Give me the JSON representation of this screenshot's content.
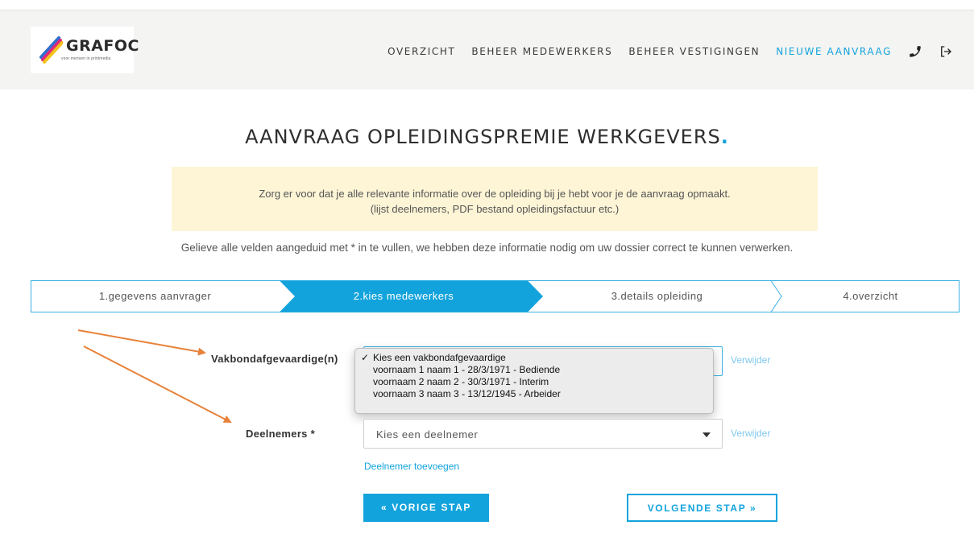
{
  "header": {
    "logo_text": "GRAFOC",
    "logo_tagline": "voor mensen in printmedia",
    "nav": [
      {
        "label": "OVERZICHT",
        "active": false
      },
      {
        "label": "BEHEER MEDEWERKERS",
        "active": false
      },
      {
        "label": "BEHEER VESTIGINGEN",
        "active": false
      },
      {
        "label": "NIEUWE AANVRAAG",
        "active": true
      }
    ],
    "icons": [
      "phone-icon",
      "logout-icon"
    ]
  },
  "page": {
    "title": "AANVRAAG OPLEIDINGSPREMIE WERKGEVERS",
    "title_dot": ".",
    "notice_line1": "Zorg er voor dat je alle relevante informatie over de opleiding bij je hebt voor je de aanvraag opmaakt.",
    "notice_line2": "(lijst deelnemers, PDF bestand opleidingsfactuur etc.)",
    "instruction": "Gelieve alle velden aangeduid met * in te vullen, we hebben deze informatie nodig om uw dossier correct te kunnen verwerken."
  },
  "steps": [
    {
      "label": "1.gegevens aanvrager",
      "active": false
    },
    {
      "label": "2.kies medewerkers",
      "active": true
    },
    {
      "label": "3.details opleiding",
      "active": false
    },
    {
      "label": "4.overzicht",
      "active": false
    }
  ],
  "form": {
    "vakbond_label": "Vakbondafgevaardige(n)",
    "vakbond_remove": "Verwijder",
    "vakbond_options": [
      "Kies een vakbondafgevaardige",
      "voornaam 1 naam 1 - 28/3/1971 - Bediende",
      "voornaam 2 naam 2 - 30/3/1971 - Interim",
      "voornaam 3 naam 3 - 13/12/1945 - Arbeider"
    ],
    "vakbond_checkmark": "✓",
    "deelnemers_label": "Deelnemers *",
    "deelnemers_value": "Kies een deelnemer",
    "deelnemers_remove": "Verwijder",
    "add_participant": "Deelnemer toevoegen"
  },
  "buttons": {
    "prev": "« VORIGE STAP",
    "next": "VOLGENDE STAP »"
  },
  "colors": {
    "accent": "#13a3dc",
    "annotation_arrow": "#e8823a",
    "notice_bg": "#fdf5d6"
  }
}
